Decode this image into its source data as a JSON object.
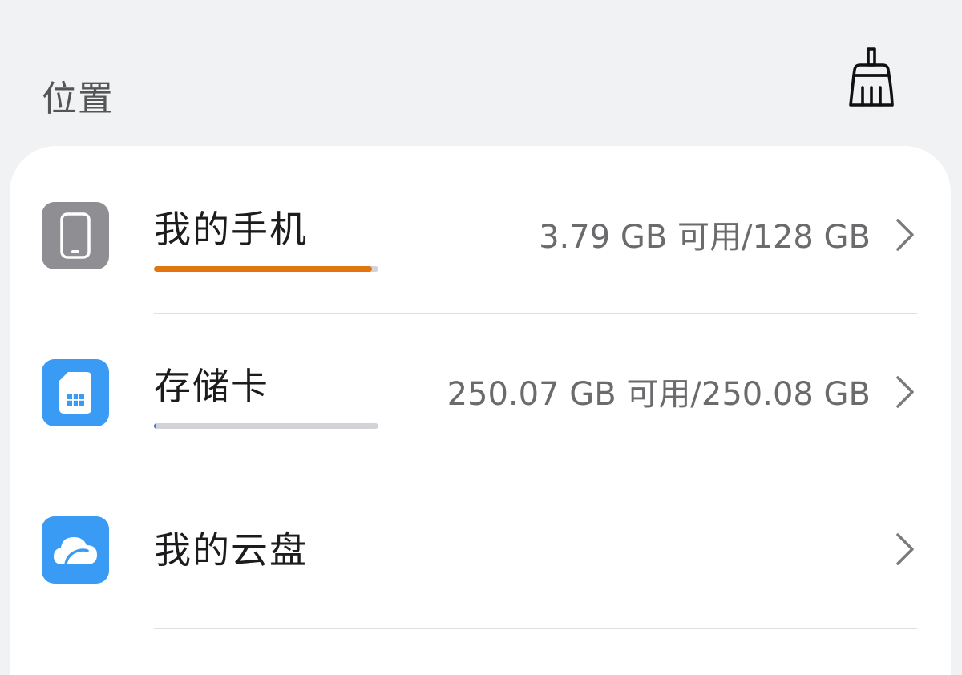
{
  "header": {
    "title": "位置",
    "clean_icon": "broom-icon"
  },
  "locations": [
    {
      "label": "我的手机",
      "icon": "phone-icon",
      "icon_color": "#8e8e93",
      "value": "3.79 GB 可用/128 GB",
      "usage_fraction": 0.97,
      "bar_color": "#e0760e"
    },
    {
      "label": "存储卡",
      "icon": "sd-card-icon",
      "icon_color": "#3a9bf5",
      "value": "250.07 GB 可用/250.08 GB",
      "usage_fraction": 0.01,
      "bar_color": "#2a7fe6"
    },
    {
      "label": "我的云盘",
      "icon": "cloud-icon",
      "icon_color": "#3a9bf5"
    }
  ]
}
